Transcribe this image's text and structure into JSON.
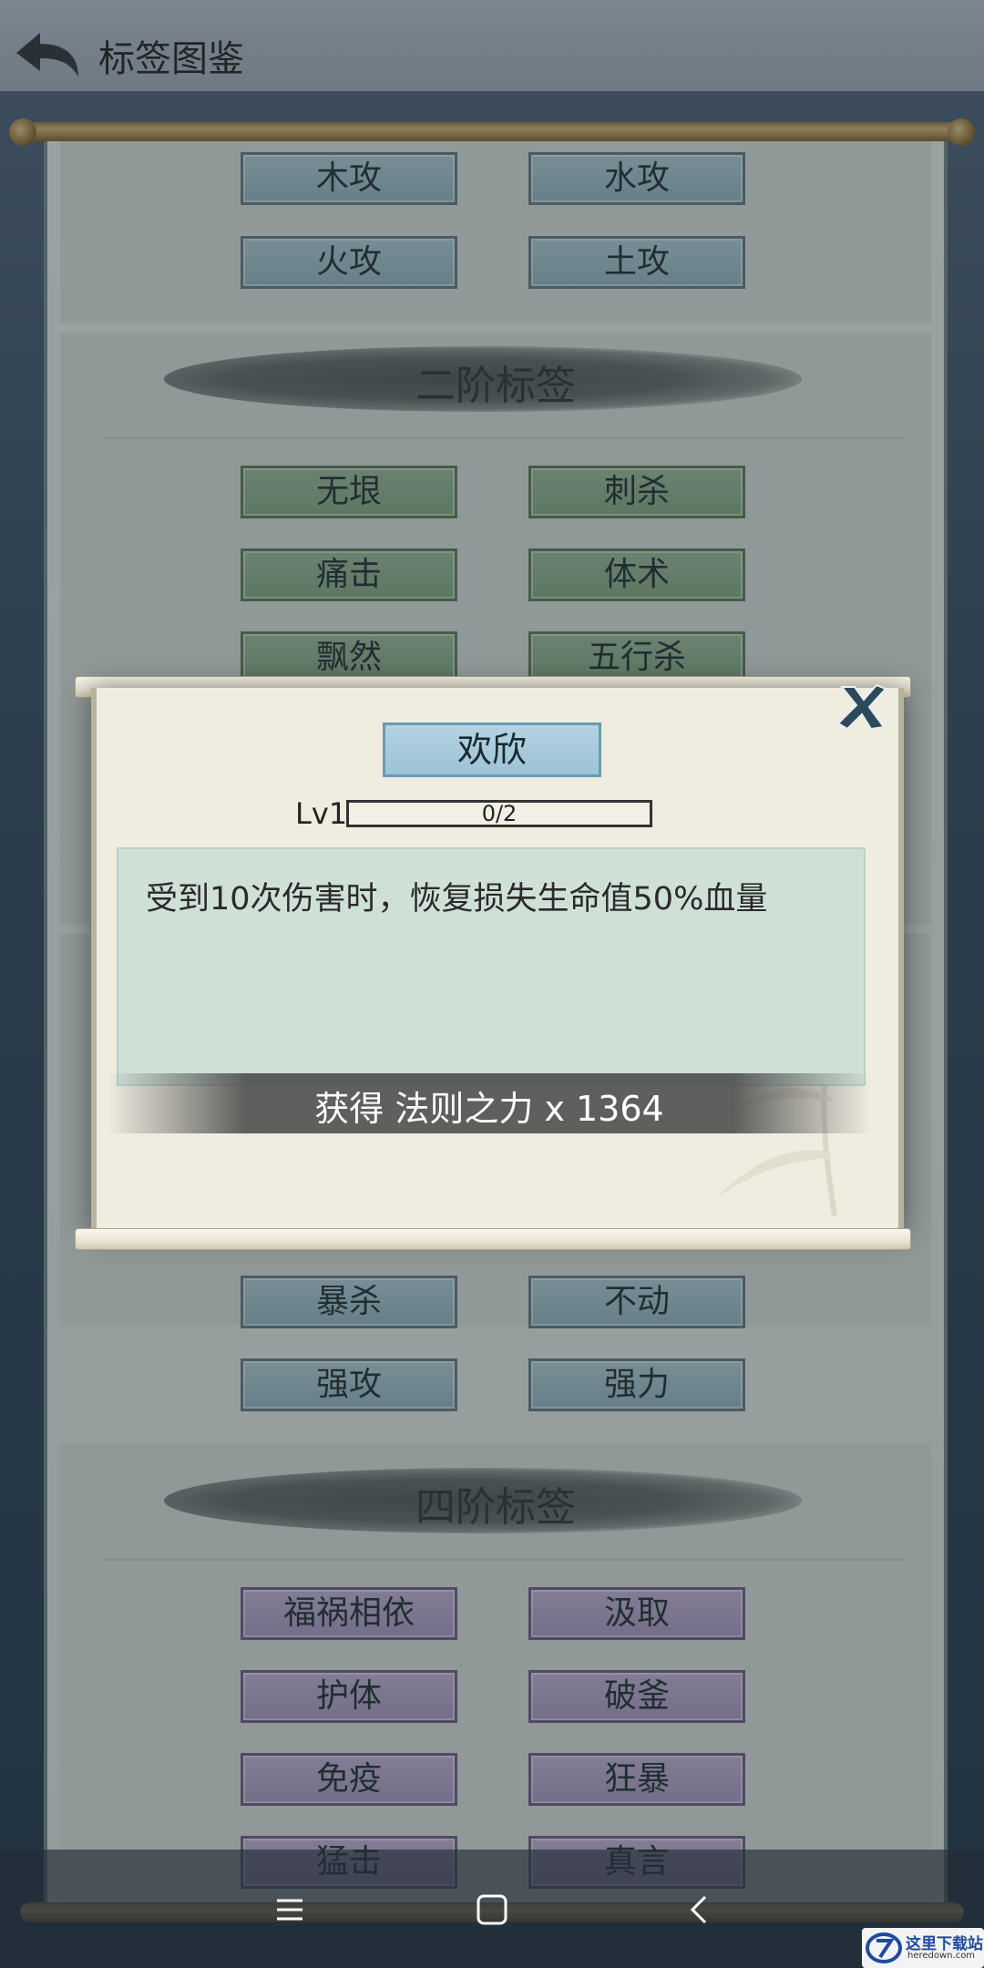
{
  "header": {
    "title": "标签图鉴"
  },
  "tags_tier1_partial": [
    "木攻",
    "水攻",
    "火攻",
    "土攻"
  ],
  "tier2": {
    "title": "二阶标签",
    "tags": [
      "无垠",
      "刺杀",
      "痛击",
      "体术",
      "飘然",
      "五行杀"
    ]
  },
  "tags_tier3_partial": [
    "暴杀",
    "不动",
    "强攻",
    "强力"
  ],
  "tier4": {
    "title": "四阶标签",
    "tags": [
      "福祸相依",
      "汲取",
      "护体",
      "破釜",
      "免疫",
      "狂暴",
      "猛击",
      "真言"
    ]
  },
  "popup": {
    "tag_name": "欢欣",
    "level_label": "Lv1",
    "progress_text": "0/2",
    "progress_current": 0,
    "progress_max": 2,
    "description": "受到10次伤害时，恢复损失生命值50%血量",
    "reward": "获得 法则之力 x 1364"
  },
  "watermark": {
    "title": "这里下载站",
    "subtitle": "heredown.com"
  },
  "icons": {
    "back": "back-arrow-icon",
    "close": "close-x-icon",
    "nav_menu": "menu-lines-icon",
    "nav_home": "home-square-icon",
    "nav_back": "chevron-left-icon"
  },
  "colors": {
    "tier1_tag": "#a4bcc6",
    "tier2_tag": "#8fab8c",
    "tier4_tag": "#b3a3c4",
    "popup_bg": "#efece0",
    "desc_bg": "#cfe0d7"
  }
}
